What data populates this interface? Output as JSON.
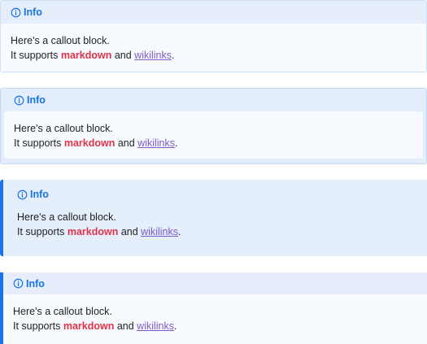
{
  "callouts": [
    {
      "icon": "info-icon",
      "title": "Info",
      "line1": "Here's a callout block.",
      "line2_prefix": "It supports ",
      "markdown": "markdown",
      "and": " and ",
      "wikilinks": "wikilinks",
      "suffix": "."
    },
    {
      "icon": "info-icon",
      "title": "Info",
      "line1": "Here's a callout block.",
      "line2_prefix": "It supports ",
      "markdown": "markdown",
      "and": " and ",
      "wikilinks": "wikilinks",
      "suffix": "."
    },
    {
      "icon": "info-icon",
      "title": "Info",
      "line1": "Here's a callout block.",
      "line2_prefix": "It supports ",
      "markdown": "markdown",
      "and": " and ",
      "wikilinks": "wikilinks",
      "suffix": "."
    },
    {
      "icon": "info-icon",
      "title": "Info",
      "line1": "Here's a callout block.",
      "line2_prefix": "It supports ",
      "markdown": "markdown",
      "and": " and ",
      "wikilinks": "wikilinks",
      "suffix": "."
    }
  ],
  "colors": {
    "accent": "#1a73e8",
    "markdown": "#e0334a",
    "wikilink": "#7c5cc4"
  }
}
